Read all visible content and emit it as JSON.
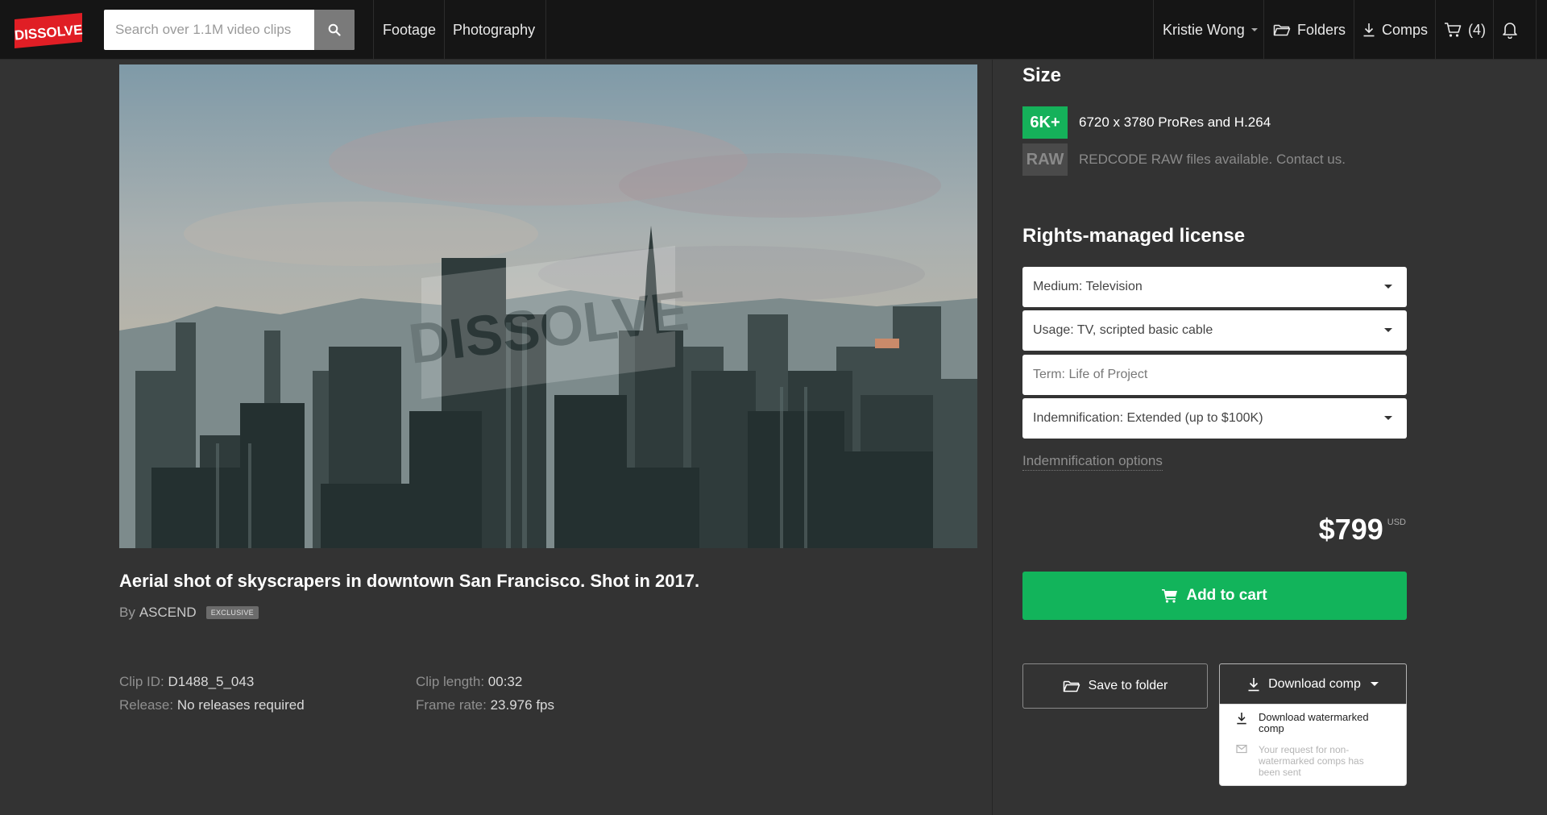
{
  "header": {
    "logo_text": "DISSOLVE",
    "search_placeholder": "Search over 1.1M video clips",
    "nav": {
      "footage": "Footage",
      "photography": "Photography"
    },
    "user_name": "Kristie Wong",
    "folders_label": "Folders",
    "comps_label": "Comps",
    "cart_count": "(4)"
  },
  "clip": {
    "title": "Aerial shot of skyscrapers in downtown San Francisco. Shot in 2017.",
    "by_label": "By",
    "author": "ASCEND",
    "exclusive_badge": "EXCLUSIVE",
    "watermark": "DISSOLVE",
    "meta": {
      "clip_id_label": "Clip ID:",
      "clip_id": "D1488_5_043",
      "release_label": "Release:",
      "release": "No releases required",
      "length_label": "Clip length:",
      "length": "00:32",
      "frame_rate_label": "Frame rate:",
      "frame_rate": "23.976 fps"
    }
  },
  "size": {
    "heading": "Size",
    "options": [
      {
        "badge": "6K+",
        "text": "6720 x 3780  ProRes and H.264"
      },
      {
        "badge": "RAW",
        "text": "REDCODE RAW files available. Contact us."
      }
    ]
  },
  "license": {
    "heading": "Rights-managed license",
    "medium": "Medium: Television",
    "usage": "Usage: TV, scripted basic cable",
    "term": "Term: Life of Project",
    "indemnification": "Indemnification: Extended (up to $100K)",
    "indemnification_link": "Indemnification options"
  },
  "pricing": {
    "amount": "$799",
    "currency": "USD"
  },
  "actions": {
    "add_to_cart": "Add to cart",
    "save_to_folder": "Save to folder",
    "download_comp": "Download comp",
    "dropdown": {
      "watermarked": "Download watermarked comp",
      "non_watermarked_note": "Your request for non-watermarked comps has been sent"
    }
  },
  "colors": {
    "accent_green": "#12b45b",
    "badge_6k": "#15b15a",
    "logo_red": "#e01e25",
    "topbar": "#151515",
    "page_bg": "#333333"
  },
  "icons": [
    "search-icon",
    "folder-icon",
    "download-icon",
    "cart-icon",
    "bell-icon",
    "mail-icon",
    "chevron-down-icon"
  ]
}
